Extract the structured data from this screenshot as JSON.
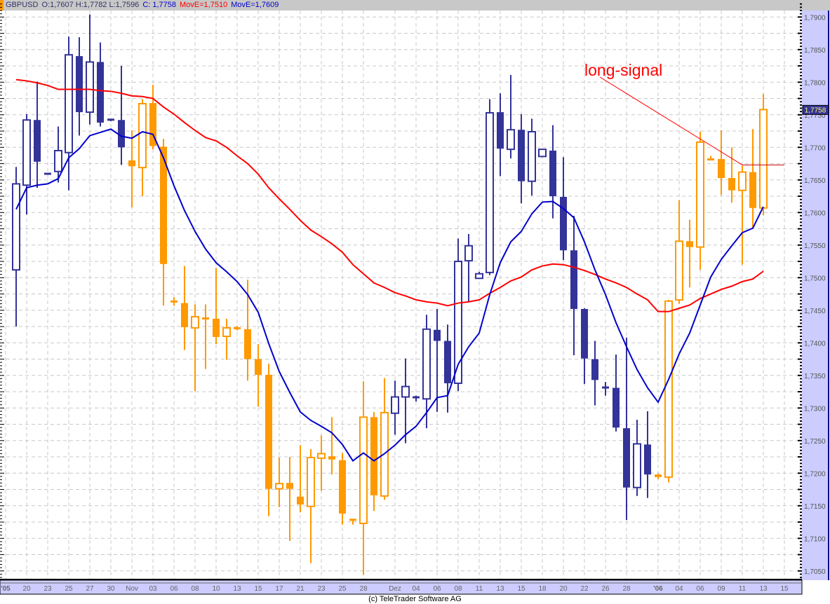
{
  "header": {
    "symbol": "GBPUSD",
    "ohlc": "O:1,7607 H:1,7782 L:1,7596",
    "close": "C: 1,7758",
    "ma_long": "MovE=1,7510",
    "ma_short": "MovE=1,7609"
  },
  "copyright": "(c) TeleTrader Software AG",
  "colors": {
    "blue_candle": "#333399",
    "orange_candle": "#ff9900",
    "ma_long": "#ff0000",
    "ma_short": "#0000cc",
    "axis_bg": "#ccccff",
    "grid": "#c8c8c8"
  },
  "chart_data": {
    "type": "candlestick",
    "title": "GBPUSD",
    "ylim": [
      1.703,
      1.792
    ],
    "y_ticks": [
      "1,7050",
      "1,7100",
      "1,7150",
      "1,7200",
      "1,7250",
      "1,7300",
      "1,7350",
      "1,7400",
      "1,7450",
      "1,7500",
      "1,7550",
      "1,7600",
      "1,7650",
      "1,7700",
      "1,7750",
      "1,7800",
      "1,7850",
      "1,7900"
    ],
    "y_tick_values": [
      1.705,
      1.71,
      1.715,
      1.72,
      1.725,
      1.73,
      1.735,
      1.74,
      1.745,
      1.75,
      1.755,
      1.76,
      1.765,
      1.77,
      1.775,
      1.78,
      1.785,
      1.79
    ],
    "x_ticks": [
      {
        "i": -1,
        "label": "'05",
        "bold": true
      },
      {
        "i": 1,
        "label": "20"
      },
      {
        "i": 3,
        "label": "23"
      },
      {
        "i": 5,
        "label": "25"
      },
      {
        "i": 7,
        "label": "27"
      },
      {
        "i": 9,
        "label": "30"
      },
      {
        "i": 11,
        "label": "Nov"
      },
      {
        "i": 13,
        "label": "03"
      },
      {
        "i": 15,
        "label": "06"
      },
      {
        "i": 17,
        "label": "08"
      },
      {
        "i": 19,
        "label": "10"
      },
      {
        "i": 21,
        "label": "13"
      },
      {
        "i": 23,
        "label": "15"
      },
      {
        "i": 25,
        "label": "17"
      },
      {
        "i": 27,
        "label": "21"
      },
      {
        "i": 29,
        "label": "23"
      },
      {
        "i": 31,
        "label": "25"
      },
      {
        "i": 33,
        "label": "28"
      },
      {
        "i": 36,
        "label": "Dez"
      },
      {
        "i": 38,
        "label": "04"
      },
      {
        "i": 40,
        "label": "06"
      },
      {
        "i": 42,
        "label": "08"
      },
      {
        "i": 44,
        "label": "11"
      },
      {
        "i": 46,
        "label": "13"
      },
      {
        "i": 48,
        "label": "15"
      },
      {
        "i": 50,
        "label": "18"
      },
      {
        "i": 52,
        "label": "20"
      },
      {
        "i": 54,
        "label": "22"
      },
      {
        "i": 56,
        "label": "26"
      },
      {
        "i": 58,
        "label": "28"
      },
      {
        "i": 61,
        "label": "'06",
        "bold": true
      },
      {
        "i": 63,
        "label": "04"
      },
      {
        "i": 65,
        "label": "06"
      },
      {
        "i": 67,
        "label": "09"
      },
      {
        "i": 69,
        "label": "11"
      },
      {
        "i": 71,
        "label": "13"
      },
      {
        "i": 73,
        "label": "15"
      }
    ],
    "candles_ohlc_color": [
      [
        1.7512,
        1.767,
        1.7425,
        1.7644,
        "b"
      ],
      [
        1.7642,
        1.7751,
        1.7597,
        1.7742,
        "b"
      ],
      [
        1.7742,
        1.7801,
        1.7638,
        1.7678,
        "b"
      ],
      [
        1.766,
        1.7661,
        1.7659,
        1.766,
        "b"
      ],
      [
        1.7663,
        1.7732,
        1.7646,
        1.7695,
        "b"
      ],
      [
        1.7692,
        1.787,
        1.7634,
        1.7842,
        "b"
      ],
      [
        1.784,
        1.7869,
        1.7718,
        1.7754,
        "b"
      ],
      [
        1.7754,
        1.7904,
        1.7735,
        1.7831,
        "b"
      ],
      [
        1.7831,
        1.7861,
        1.7732,
        1.7738,
        "b"
      ],
      [
        1.7743,
        1.7744,
        1.774,
        1.7741,
        "b"
      ],
      [
        1.7742,
        1.7825,
        1.7673,
        1.77,
        "b"
      ],
      [
        1.768,
        1.7726,
        1.7608,
        1.7671,
        "o"
      ],
      [
        1.7669,
        1.7774,
        1.7625,
        1.7767,
        "o"
      ],
      [
        1.7768,
        1.7796,
        1.7697,
        1.7702,
        "o"
      ],
      [
        1.7701,
        1.7713,
        1.7457,
        1.7521,
        "o"
      ],
      [
        1.7464,
        1.747,
        1.7457,
        1.7463,
        "o"
      ],
      [
        1.7461,
        1.7518,
        1.7389,
        1.7424,
        "o"
      ],
      [
        1.7423,
        1.7459,
        1.7326,
        1.744,
        "o"
      ],
      [
        1.7438,
        1.7459,
        1.736,
        1.7437,
        "o"
      ],
      [
        1.7437,
        1.7515,
        1.7398,
        1.7409,
        "o"
      ],
      [
        1.741,
        1.7437,
        1.7374,
        1.7423,
        "o"
      ],
      [
        1.7423,
        1.7426,
        1.7419,
        1.7422,
        "o"
      ],
      [
        1.7421,
        1.7497,
        1.7342,
        1.7375,
        "o"
      ],
      [
        1.7375,
        1.7398,
        1.7302,
        1.7351,
        "o"
      ],
      [
        1.7351,
        1.7368,
        1.7134,
        1.7176,
        "o"
      ],
      [
        1.7176,
        1.7224,
        1.7148,
        1.7184,
        "o"
      ],
      [
        1.7185,
        1.7225,
        1.7096,
        1.7176,
        "o"
      ],
      [
        1.7164,
        1.7243,
        1.714,
        1.7152,
        "o"
      ],
      [
        1.7149,
        1.7237,
        1.7062,
        1.7224,
        "o"
      ],
      [
        1.7223,
        1.7258,
        1.7173,
        1.723,
        "o"
      ],
      [
        1.7226,
        1.7286,
        1.7198,
        1.7221,
        "o"
      ],
      [
        1.722,
        1.7231,
        1.7121,
        1.7138,
        "o"
      ],
      [
        1.7129,
        1.713,
        1.7121,
        1.7126,
        "o"
      ],
      [
        1.7123,
        1.7341,
        1.7044,
        1.7286,
        "o"
      ],
      [
        1.7286,
        1.7294,
        1.7142,
        1.7166,
        "o"
      ],
      [
        1.7165,
        1.7346,
        1.7159,
        1.7293,
        "o"
      ],
      [
        1.7292,
        1.7342,
        1.7259,
        1.7317,
        "b"
      ],
      [
        1.7317,
        1.7376,
        1.7246,
        1.7333,
        "b"
      ],
      [
        1.7317,
        1.7319,
        1.731,
        1.7316,
        "b"
      ],
      [
        1.7314,
        1.7443,
        1.7269,
        1.7421,
        "b"
      ],
      [
        1.742,
        1.7452,
        1.7294,
        1.7403,
        "b"
      ],
      [
        1.7403,
        1.7428,
        1.7293,
        1.7338,
        "b"
      ],
      [
        1.7338,
        1.756,
        1.7326,
        1.7525,
        "b"
      ],
      [
        1.7526,
        1.7567,
        1.7463,
        1.7549,
        "b"
      ],
      [
        1.7499,
        1.7509,
        1.7498,
        1.7506,
        "b"
      ],
      [
        1.7508,
        1.7774,
        1.7504,
        1.7753,
        "b"
      ],
      [
        1.7754,
        1.7783,
        1.7656,
        1.7698,
        "b"
      ],
      [
        1.7697,
        1.7811,
        1.7683,
        1.7727,
        "b"
      ],
      [
        1.7727,
        1.7751,
        1.7614,
        1.7648,
        "b"
      ],
      [
        1.7648,
        1.7744,
        1.7626,
        1.7724,
        "b"
      ],
      [
        1.7686,
        1.7698,
        1.7685,
        1.7697,
        "b"
      ],
      [
        1.7695,
        1.7734,
        1.7591,
        1.7625,
        "b"
      ],
      [
        1.7624,
        1.7685,
        1.7527,
        1.7542,
        "b"
      ],
      [
        1.7542,
        1.7595,
        1.7381,
        1.7452,
        "b"
      ],
      [
        1.7452,
        1.7453,
        1.7337,
        1.7376,
        "b"
      ],
      [
        1.7375,
        1.7403,
        1.7304,
        1.7343,
        "b"
      ],
      [
        1.7332,
        1.734,
        1.7319,
        1.7331,
        "b"
      ],
      [
        1.7331,
        1.7382,
        1.7264,
        1.727,
        "b"
      ],
      [
        1.7269,
        1.7408,
        1.7128,
        1.7178,
        "b"
      ],
      [
        1.7178,
        1.7282,
        1.7165,
        1.7245,
        "b"
      ],
      [
        1.7244,
        1.7295,
        1.7162,
        1.7198,
        "b"
      ],
      [
        1.7198,
        1.7199,
        1.7191,
        1.7194,
        "o"
      ],
      [
        1.7194,
        1.7466,
        1.7186,
        1.7464,
        "o"
      ],
      [
        1.7466,
        1.7619,
        1.746,
        1.7556,
        "o"
      ],
      [
        1.7556,
        1.7589,
        1.7485,
        1.7547,
        "o"
      ],
      [
        1.7547,
        1.7724,
        1.7512,
        1.7708,
        "o"
      ],
      [
        1.7682,
        1.7687,
        1.7681,
        1.7681,
        "o"
      ],
      [
        1.7682,
        1.7726,
        1.7627,
        1.7653,
        "o"
      ],
      [
        1.7653,
        1.77,
        1.7615,
        1.7634,
        "o"
      ],
      [
        1.7634,
        1.7672,
        1.752,
        1.7662,
        "o"
      ],
      [
        1.7662,
        1.7728,
        1.7576,
        1.7607,
        "o"
      ],
      [
        1.7607,
        1.7782,
        1.7596,
        1.7758,
        "o"
      ]
    ],
    "series": [
      {
        "name": "MovE (long)",
        "color": "#ff0000",
        "values": [
          1.7804,
          1.7802,
          1.7799,
          1.7795,
          1.7789,
          1.7789,
          1.7789,
          1.7789,
          1.7787,
          1.7786,
          1.7783,
          1.7779,
          1.7778,
          1.7775,
          1.7762,
          1.7751,
          1.7738,
          1.7726,
          1.7715,
          1.771,
          1.77,
          1.7687,
          1.7675,
          1.7659,
          1.7638,
          1.7621,
          1.7605,
          1.7588,
          1.7573,
          1.7563,
          1.7552,
          1.7539,
          1.752,
          1.7506,
          1.7492,
          1.7485,
          1.7477,
          1.7472,
          1.7466,
          1.7463,
          1.7461,
          1.7457,
          1.7461,
          1.7463,
          1.7466,
          1.7476,
          1.7485,
          1.7495,
          1.7501,
          1.7512,
          1.7518,
          1.7521,
          1.752,
          1.7516,
          1.7511,
          1.7505,
          1.7498,
          1.7492,
          1.7485,
          1.7475,
          1.7466,
          1.7448,
          1.7448,
          1.7453,
          1.7458,
          1.7468,
          1.7475,
          1.7482,
          1.7487,
          1.7494,
          1.7498,
          1.751
        ]
      },
      {
        "name": "MovE (short)",
        "color": "#0000cc",
        "values": [
          1.7605,
          1.7638,
          1.7642,
          1.7644,
          1.7652,
          1.7684,
          1.7698,
          1.7718,
          1.7723,
          1.7728,
          1.7717,
          1.7714,
          1.7724,
          1.772,
          1.7684,
          1.7641,
          1.7603,
          1.7571,
          1.7544,
          1.7523,
          1.7509,
          1.7494,
          1.7474,
          1.7447,
          1.7399,
          1.7356,
          1.7324,
          1.7294,
          1.7281,
          1.7272,
          1.7262,
          1.7244,
          1.7219,
          1.7231,
          1.7219,
          1.723,
          1.7243,
          1.7259,
          1.7272,
          1.7293,
          1.7316,
          1.7319,
          1.7367,
          1.7394,
          1.7415,
          1.7474,
          1.7523,
          1.7555,
          1.7571,
          1.7598,
          1.7616,
          1.7617,
          1.7606,
          1.7592,
          1.7555,
          1.7512,
          1.7474,
          1.7431,
          1.7394,
          1.7359,
          1.7331,
          1.7309,
          1.7344,
          1.7383,
          1.7415,
          1.7458,
          1.7501,
          1.7528,
          1.7549,
          1.7569,
          1.7576,
          1.7609
        ]
      }
    ],
    "annotation": {
      "text": "long-signal",
      "signal_level": 1.7673,
      "from_candle": 54,
      "to_candle": 70
    },
    "last_price_label": "1,7758",
    "last_price": 1.7758,
    "grid": true
  }
}
